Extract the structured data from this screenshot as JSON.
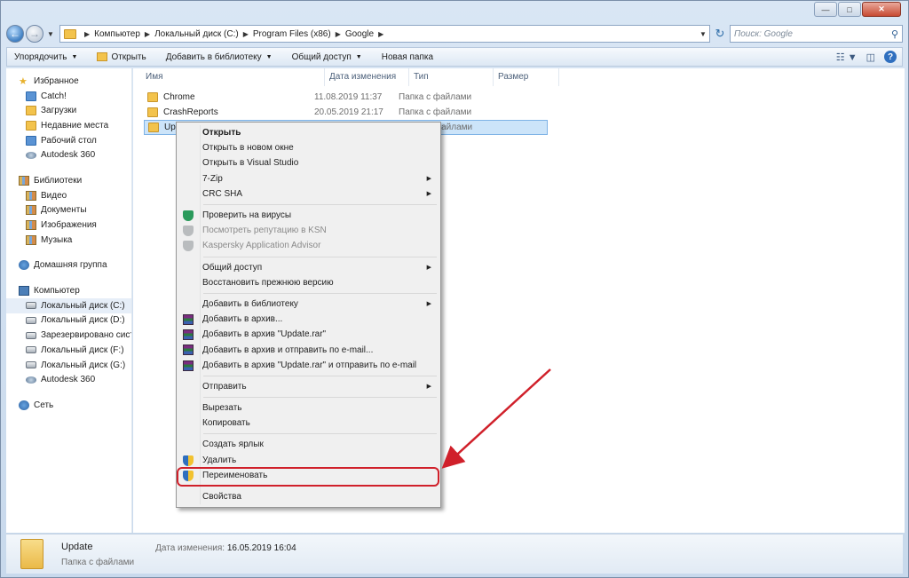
{
  "breadcrumb": [
    "Компьютер",
    "Локальный диск (C:)",
    "Program Files (x86)",
    "Google"
  ],
  "search": {
    "placeholder": "Поиск: Google"
  },
  "toolbar": {
    "organize": "Упорядочить",
    "open": "Открыть",
    "add_to_library": "Добавить в библиотеку",
    "share": "Общий доступ",
    "new_folder": "Новая папка"
  },
  "nav": {
    "favorites": {
      "label": "Избранное",
      "items": [
        "Catch!",
        "Загрузки",
        "Недавние места",
        "Рабочий стол",
        "Autodesk 360"
      ]
    },
    "libraries": {
      "label": "Библиотеки",
      "items": [
        "Видео",
        "Документы",
        "Изображения",
        "Музыка"
      ]
    },
    "homegroup": "Домашняя группа",
    "computer": {
      "label": "Компьютер",
      "items": [
        "Локальный диск (C:)",
        "Локальный диск (D:)",
        "Зарезервировано систе",
        "Локальный диск (F:)",
        "Локальный диск (G:)",
        "Autodesk 360"
      ]
    },
    "network": "Сеть"
  },
  "columns": {
    "name": "Имя",
    "date": "Дата изменения",
    "type": "Тип",
    "size": "Размер"
  },
  "files": [
    {
      "name": "Chrome",
      "date": "11.08.2019 11:37",
      "type": "Папка с файлами"
    },
    {
      "name": "CrashReports",
      "date": "20.05.2019 21:17",
      "type": "Папка с файлами"
    },
    {
      "name": "Update",
      "date": "",
      "type": "Папка с файлами"
    }
  ],
  "context_menu": {
    "open": "Открыть",
    "open_new_window": "Открыть в новом окне",
    "open_vs": "Открыть в Visual Studio",
    "zip7": "7-Zip",
    "crc": "CRC SHA",
    "scan": "Проверить на вирусы",
    "ksn": "Посмотреть репутацию в KSN",
    "kaspersky": "Kaspersky Application Advisor",
    "share": "Общий доступ",
    "restore": "Восстановить прежнюю версию",
    "add_library": "Добавить в библиотеку",
    "add_archive": "Добавить в архив...",
    "add_archive_rar": "Добавить в архив \"Update.rar\"",
    "archive_email": "Добавить в архив и отправить по e-mail...",
    "archive_rar_email": "Добавить в архив \"Update.rar\" и отправить по e-mail",
    "send_to": "Отправить",
    "cut": "Вырезать",
    "copy": "Копировать",
    "shortcut": "Создать ярлык",
    "delete": "Удалить",
    "rename": "Переименовать",
    "properties": "Свойства"
  },
  "details": {
    "name": "Update",
    "type": "Папка с файлами",
    "date_label": "Дата изменения:",
    "date_value": "16.05.2019 16:04"
  },
  "colors": {
    "highlight": "#d0202a",
    "selection": "#cce4f9"
  }
}
